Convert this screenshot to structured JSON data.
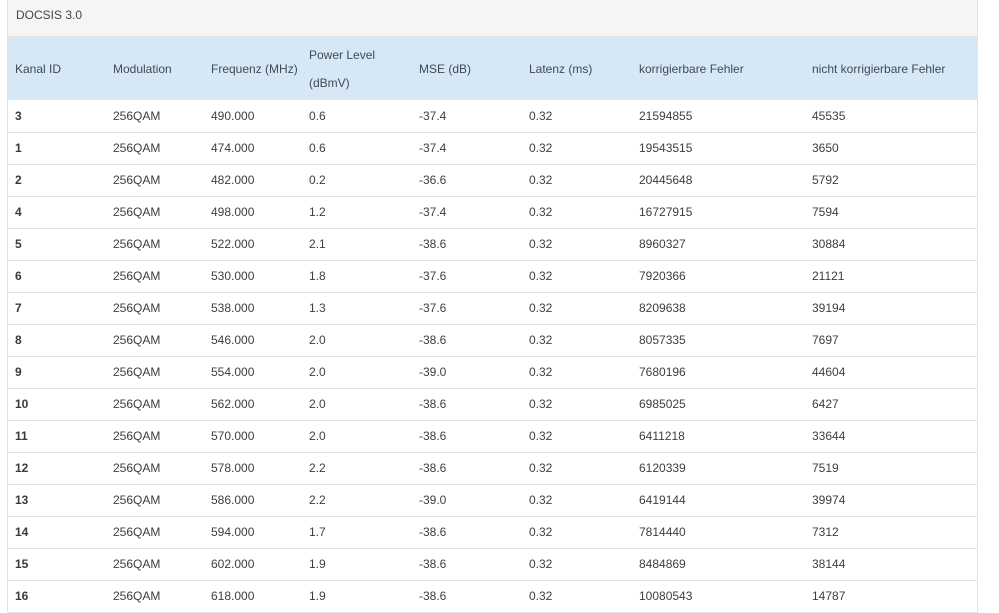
{
  "panel": {
    "title": "DOCSIS 3.0"
  },
  "table": {
    "headers": {
      "kanal_id": "Kanal ID",
      "modulation": "Modulation",
      "frequenz": "Frequenz (MHz)",
      "power_level_line1": "Power Level",
      "power_level_line2": "(dBmV)",
      "mse": "MSE (dB)",
      "latenz": "Latenz (ms)",
      "korrigierbare": "korrigierbare Fehler",
      "nicht_korrigierbare": "nicht korrigierbare Fehler"
    },
    "rows": [
      {
        "id": "3",
        "modulation": "256QAM",
        "freq": "490.000",
        "power": "0.6",
        "mse": "-37.4",
        "latenz": "0.32",
        "korr": "21594855",
        "nicht": "45535"
      },
      {
        "id": "1",
        "modulation": "256QAM",
        "freq": "474.000",
        "power": "0.6",
        "mse": "-37.4",
        "latenz": "0.32",
        "korr": "19543515",
        "nicht": "3650"
      },
      {
        "id": "2",
        "modulation": "256QAM",
        "freq": "482.000",
        "power": "0.2",
        "mse": "-36.6",
        "latenz": "0.32",
        "korr": "20445648",
        "nicht": "5792"
      },
      {
        "id": "4",
        "modulation": "256QAM",
        "freq": "498.000",
        "power": "1.2",
        "mse": "-37.4",
        "latenz": "0.32",
        "korr": "16727915",
        "nicht": "7594"
      },
      {
        "id": "5",
        "modulation": "256QAM",
        "freq": "522.000",
        "power": "2.1",
        "mse": "-38.6",
        "latenz": "0.32",
        "korr": "8960327",
        "nicht": "30884"
      },
      {
        "id": "6",
        "modulation": "256QAM",
        "freq": "530.000",
        "power": "1.8",
        "mse": "-37.6",
        "latenz": "0.32",
        "korr": "7920366",
        "nicht": "21121"
      },
      {
        "id": "7",
        "modulation": "256QAM",
        "freq": "538.000",
        "power": "1.3",
        "mse": "-37.6",
        "latenz": "0.32",
        "korr": "8209638",
        "nicht": "39194"
      },
      {
        "id": "8",
        "modulation": "256QAM",
        "freq": "546.000",
        "power": "2.0",
        "mse": "-38.6",
        "latenz": "0.32",
        "korr": "8057335",
        "nicht": "7697"
      },
      {
        "id": "9",
        "modulation": "256QAM",
        "freq": "554.000",
        "power": "2.0",
        "mse": "-39.0",
        "latenz": "0.32",
        "korr": "7680196",
        "nicht": "44604"
      },
      {
        "id": "10",
        "modulation": "256QAM",
        "freq": "562.000",
        "power": "2.0",
        "mse": "-38.6",
        "latenz": "0.32",
        "korr": "6985025",
        "nicht": "6427"
      },
      {
        "id": "11",
        "modulation": "256QAM",
        "freq": "570.000",
        "power": "2.0",
        "mse": "-38.6",
        "latenz": "0.32",
        "korr": "6411218",
        "nicht": "33644"
      },
      {
        "id": "12",
        "modulation": "256QAM",
        "freq": "578.000",
        "power": "2.2",
        "mse": "-38.6",
        "latenz": "0.32",
        "korr": "6120339",
        "nicht": "7519"
      },
      {
        "id": "13",
        "modulation": "256QAM",
        "freq": "586.000",
        "power": "2.2",
        "mse": "-39.0",
        "latenz": "0.32",
        "korr": "6419144",
        "nicht": "39974"
      },
      {
        "id": "14",
        "modulation": "256QAM",
        "freq": "594.000",
        "power": "1.7",
        "mse": "-38.6",
        "latenz": "0.32",
        "korr": "7814440",
        "nicht": "7312"
      },
      {
        "id": "15",
        "modulation": "256QAM",
        "freq": "602.000",
        "power": "1.9",
        "mse": "-38.6",
        "latenz": "0.32",
        "korr": "8484869",
        "nicht": "38144"
      },
      {
        "id": "16",
        "modulation": "256QAM",
        "freq": "618.000",
        "power": "1.9",
        "mse": "-38.6",
        "latenz": "0.32",
        "korr": "10080543",
        "nicht": "14787"
      }
    ]
  }
}
